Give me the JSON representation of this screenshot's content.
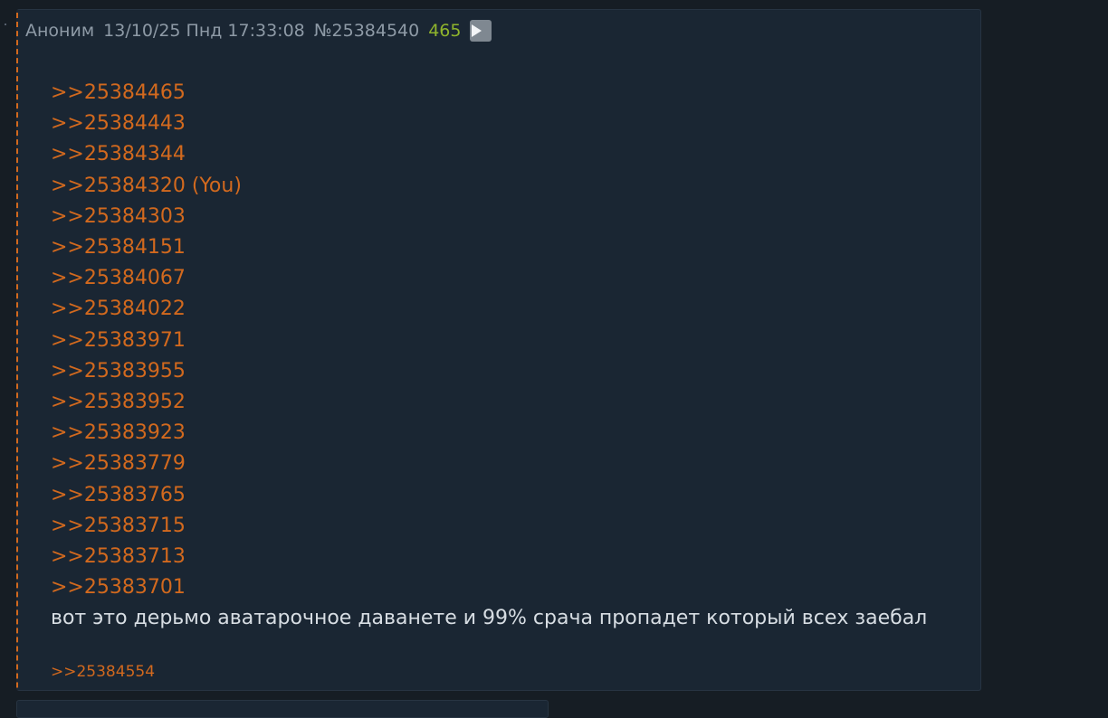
{
  "post": {
    "author": "Аноним",
    "datetime": "13/10/25 Пнд 17:33:08",
    "number": "№25384540",
    "count": "465",
    "play_icon": "play-icon",
    "replies": [
      ">>25384465",
      ">>25384443",
      ">>25384344",
      ">>25384320 (You)",
      ">>25384303",
      ">>25384151",
      ">>25384067",
      ">>25384022",
      ">>25383971",
      ">>25383955",
      ">>25383952",
      ">>25383923",
      ">>25383779",
      ">>25383765",
      ">>25383715",
      ">>25383713",
      ">>25383701"
    ],
    "message": "вот это дерьмо аватарочное даванете и 99% срача пропадет который всех заебал",
    "backlinks": [
      ">>25384554"
    ]
  },
  "colors": {
    "background": "#161d24",
    "post_background": "#1a2633",
    "reply_link": "#d2691e",
    "count": "#8fb42c",
    "header_text": "#8e9aa6",
    "message_text": "#d7dde3"
  }
}
